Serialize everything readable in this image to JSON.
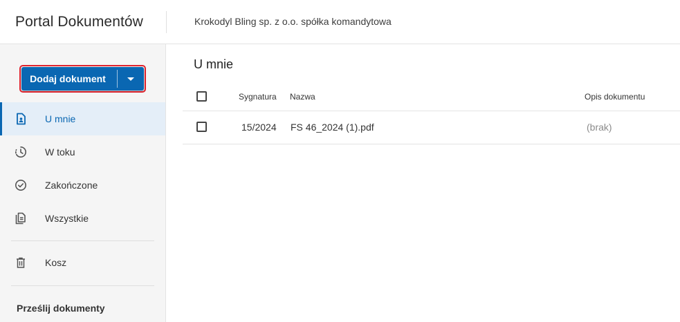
{
  "header": {
    "app_title": "Portal Dokumentów",
    "company_name": "Krokodyl Bling sp. z o.o. spółka komandytowa"
  },
  "sidebar": {
    "add_button_label": "Dodaj dokument",
    "items": [
      {
        "label": "U mnie",
        "icon": "person-document-icon",
        "active": true
      },
      {
        "label": "W toku",
        "icon": "clock-icon",
        "active": false
      },
      {
        "label": "Zakończone",
        "icon": "check-circle-icon",
        "active": false
      },
      {
        "label": "Wszystkie",
        "icon": "documents-icon",
        "active": false
      },
      {
        "label": "Kosz",
        "icon": "trash-icon",
        "active": false
      }
    ],
    "section_heading": "Prześlij dokumenty"
  },
  "main": {
    "title": "U mnie",
    "table": {
      "columns": [
        "Sygnatura",
        "Nazwa",
        "Opis dokumentu"
      ],
      "rows": [
        {
          "sygnatura": "15/2024",
          "nazwa": "FS 46_2024 (1).pdf",
          "opis": "(brak)"
        }
      ]
    }
  },
  "colors": {
    "primary": "#0a67b2",
    "highlight_border": "#e0222d",
    "active_bg": "#e4eef8"
  }
}
